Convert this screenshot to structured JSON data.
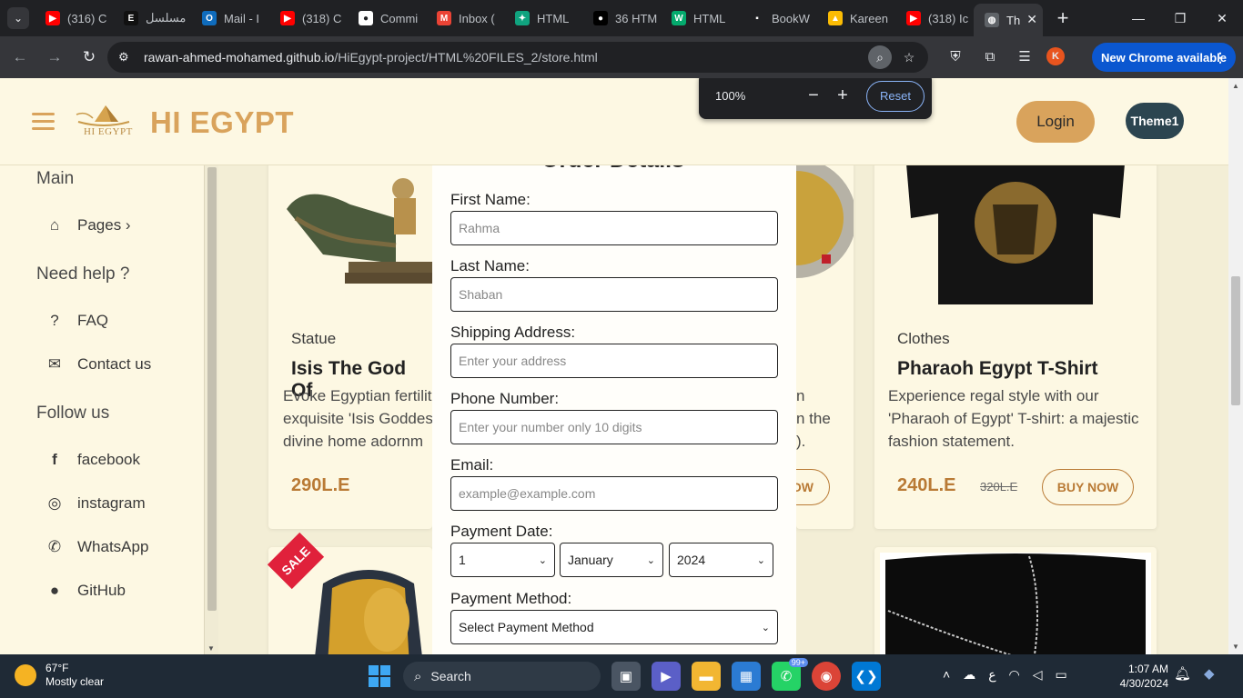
{
  "browser": {
    "tabs": [
      {
        "title": "(316) C",
        "icon": "youtube-icon",
        "color": "#ff0000"
      },
      {
        "title": "مسلسل",
        "icon": "ed-icon",
        "color": "#111111"
      },
      {
        "title": "Mail - I",
        "icon": "outlook-icon",
        "color": "#0f6cbd"
      },
      {
        "title": "(318) C",
        "icon": "youtube-icon",
        "color": "#ff0000"
      },
      {
        "title": "Commi",
        "icon": "github-icon",
        "color": "#ffffff"
      },
      {
        "title": "Inbox (",
        "icon": "gmail-icon",
        "color": "#ea4335"
      },
      {
        "title": "HTML",
        "icon": "chatgpt-icon",
        "color": "#10a37f"
      },
      {
        "title": "36 HTM",
        "icon": "medium-icon",
        "color": "#000000"
      },
      {
        "title": "HTML",
        "icon": "w3schools-icon",
        "color": "#04aa6d"
      },
      {
        "title": "BookW",
        "icon": "bookw-icon",
        "color": "#202124"
      },
      {
        "title": "Kareen",
        "icon": "drive-icon",
        "color": "#fbbc04"
      },
      {
        "title": "(318) Ic",
        "icon": "youtube-icon",
        "color": "#ff0000"
      }
    ],
    "active_tab": {
      "title": "Th",
      "icon": "globe-icon"
    },
    "url_host": "rawan-ahmed-mohamed.github.io",
    "url_path": "/HiEgypt-project/HTML%20FILES_2/store.html",
    "update_label": "New Chrome available",
    "profile_initial": "K"
  },
  "zoom_popup": {
    "level": "100%",
    "minus": "−",
    "plus": "+",
    "reset": "Reset"
  },
  "header": {
    "brand": "HI EGYPT",
    "logo_text": "HI EGYPT",
    "login": "Login",
    "theme": "Theme1"
  },
  "sidebar": {
    "main": "Main",
    "pages": "Pages ›",
    "help": "Need help ?",
    "faq": "FAQ",
    "contact": "Contact us",
    "follow": "Follow us",
    "facebook": "facebook",
    "instagram": "instagram",
    "whatsapp": "WhatsApp",
    "github": "GitHub"
  },
  "products": {
    "p1": {
      "category": "Statue",
      "title": "Isis The God Of",
      "desc1": "Evoke Egyptian fertilit",
      "desc2": "exquisite 'Isis Goddes",
      "desc3": "divine home adornm",
      "price": "290L.E"
    },
    "p2": {
      "desc1": "n",
      "desc2": "n the",
      "desc3": ").",
      "buy": "OW"
    },
    "p3": {
      "category": "Clothes",
      "title": "Pharaoh Egypt T-Shirt",
      "desc1": "Experience regal style with our",
      "desc2": "'Pharaoh of Egypt' T-shirt: a majestic",
      "desc3": "fashion statement.",
      "price": "240L.E",
      "old_price": "320L.E",
      "buy": "BUY NOW"
    },
    "sale": "SALE"
  },
  "order_form": {
    "title": "Order Details",
    "first_name_label": "First Name:",
    "first_name_placeholder": "Rahma",
    "last_name_label": "Last Name:",
    "last_name_placeholder": "Shaban",
    "address_label": "Shipping Address:",
    "address_placeholder": "Enter your address",
    "phone_label": "Phone Number:",
    "phone_placeholder": "Enter your number only 10 digits",
    "email_label": "Email:",
    "email_placeholder": "example@example.com",
    "date_label": "Payment Date:",
    "day": "1",
    "month": "January",
    "year": "2024",
    "method_label": "Payment Method:",
    "method_value": "Select Payment Method"
  },
  "taskbar": {
    "temp": "67°F",
    "weather": "Mostly clear",
    "search": "Search",
    "whatsapp_badge": "99+",
    "lang": "ع",
    "time": "1:07 AM",
    "date": "4/30/2024"
  }
}
